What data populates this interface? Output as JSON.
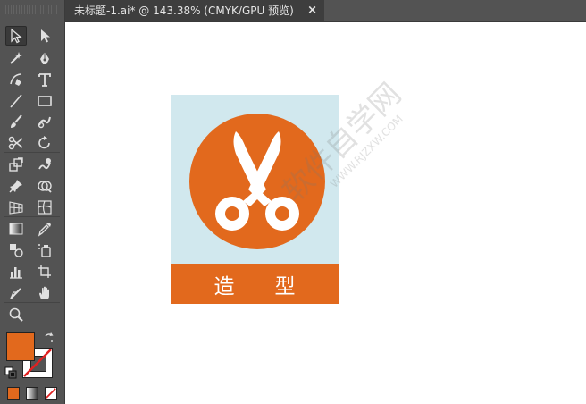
{
  "document_tab": {
    "title": "未标题-1.ai* @ 143.38% (CMYK/GPU 预览)",
    "close_glyph": "×"
  },
  "tools": [
    {
      "name": "selection-tool",
      "icon": "arrow-outline-icon",
      "active": true
    },
    {
      "name": "direct-selection-tool",
      "icon": "arrow-filled-icon"
    },
    {
      "name": "magic-wand-tool",
      "icon": "magic-wand-icon"
    },
    {
      "name": "pen-tool",
      "icon": "pen-icon"
    },
    {
      "name": "curvature-tool",
      "icon": "curvature-pen-icon"
    },
    {
      "name": "type-tool",
      "icon": "type-icon"
    },
    {
      "name": "line-segment-tool",
      "icon": "line-icon"
    },
    {
      "name": "rectangle-tool",
      "icon": "rectangle-icon"
    },
    {
      "name": "paintbrush-tool",
      "icon": "brush-icon"
    },
    {
      "name": "shaper-tool",
      "icon": "shaper-icon"
    },
    {
      "name": "scissors-tool",
      "icon": "scissors-icon"
    },
    {
      "name": "rotate-tool",
      "icon": "rotate-icon"
    },
    {
      "name": "scale-tool",
      "icon": "scale-icon"
    },
    {
      "name": "warp-tool",
      "icon": "warp-icon"
    },
    {
      "name": "puppet-warp-tool",
      "icon": "pin-icon"
    },
    {
      "name": "shape-builder-tool",
      "icon": "shape-builder-icon"
    },
    {
      "name": "perspective-grid-tool",
      "icon": "perspective-grid-icon"
    },
    {
      "name": "mesh-tool",
      "icon": "mesh-icon"
    },
    {
      "name": "gradient-tool",
      "icon": "gradient-icon"
    },
    {
      "name": "eyedropper-tool",
      "icon": "eyedropper-icon"
    },
    {
      "name": "blend-tool",
      "icon": "blend-icon"
    },
    {
      "name": "symbol-sprayer-tool",
      "icon": "symbol-sprayer-icon"
    },
    {
      "name": "column-graph-tool",
      "icon": "column-graph-icon"
    },
    {
      "name": "artboard-tool",
      "icon": "artboard-icon"
    },
    {
      "name": "slice-tool",
      "icon": "slice-icon"
    },
    {
      "name": "hand-tool",
      "icon": "hand-icon"
    },
    {
      "name": "zoom-tool",
      "icon": "zoom-icon"
    }
  ],
  "colors": {
    "fill": "#e2691d",
    "stroke": "none",
    "accent": "#e2691d",
    "artboard_bg": "#d1e8ee",
    "ui_bg": "#535353"
  },
  "artwork": {
    "label_char_1": "造",
    "label_char_2": "型"
  },
  "watermark": {
    "text": "软件自学网",
    "url": "WWW.RJZXW.COM"
  }
}
